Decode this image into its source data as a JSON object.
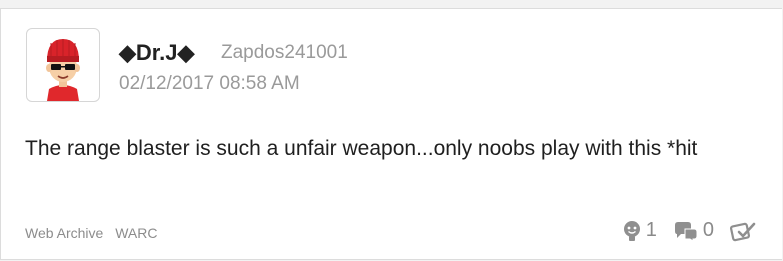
{
  "post": {
    "display_name": "◆Dr.J◆",
    "handle": "Zapdos241001",
    "timestamp": "02/12/2017 08:58 AM",
    "body": "The range blaster is such a unfair weapon...only noobs play with this *hit",
    "footer_links": [
      "Web Archive",
      "WARC"
    ],
    "yeah_count": "1",
    "reply_count": "0",
    "icons": {
      "avatar": "mii-avatar",
      "yeah": "yeah-icon",
      "reply": "reply-icon",
      "played": "played-icon"
    }
  }
}
